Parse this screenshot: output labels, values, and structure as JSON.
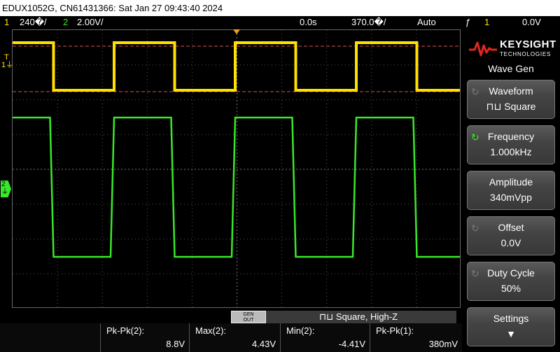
{
  "title_bar": "EDUX1052G, CN61431366: Sat Jan 27 09:43:40 2024",
  "status_bar": {
    "ch1_num": "1",
    "ch1_scale": "240�/",
    "ch2_num": "2",
    "ch2_scale": "2.00V/",
    "time_delay": "0.0s",
    "time_scale": "370.0�/",
    "trigger_mode": "Auto",
    "trigger_icon": "rising-edge-icon",
    "trigger_source": "1",
    "trigger_level": "0.0V"
  },
  "markers": {
    "trig_level": "T",
    "ch1": "1",
    "ch2": "2"
  },
  "colors": {
    "ch1": "#ffe000",
    "ch2": "#39e82a",
    "trigger_marker": "#f0a020",
    "grid": "#555555",
    "ref_line": "#e05050"
  },
  "logo": {
    "brand": "KEYSIGHT",
    "sub": "TECHNOLOGIES"
  },
  "menu": {
    "title": "Wave Gen",
    "softkeys": [
      {
        "label": "Waveform",
        "value": "⊓⊔ Square",
        "knob": "entry-knob-icon",
        "active": false
      },
      {
        "label": "Frequency",
        "value": "1.000kHz",
        "knob": "entry-knob-icon",
        "active": true
      },
      {
        "label": "Amplitude",
        "value": "340mVpp",
        "knob": "",
        "active": false
      },
      {
        "label": "Offset",
        "value": "0.0V",
        "knob": "entry-knob-icon",
        "active": false
      },
      {
        "label": "Duty Cycle",
        "value": "50%",
        "knob": "entry-knob-icon",
        "active": false
      },
      {
        "label": "Settings",
        "value": "▼",
        "knob": "",
        "active": false
      }
    ]
  },
  "gen_bar": {
    "badge_top": "GEN",
    "badge_bottom": "OUT",
    "status": "⊓⊔ Square, High-Z"
  },
  "measurements": [
    {
      "label": "Pk-Pk(2):",
      "value": "8.8V"
    },
    {
      "label": "Max(2):",
      "value": "4.43V"
    },
    {
      "label": "Min(2):",
      "value": "-4.41V"
    },
    {
      "label": "Pk-Pk(1):",
      "value": "380mV"
    }
  ],
  "traces": {
    "period_ms": 1.0,
    "duty_percent": 50,
    "ch2_high_V": 4.43,
    "ch2_low_V": -4.41
  }
}
